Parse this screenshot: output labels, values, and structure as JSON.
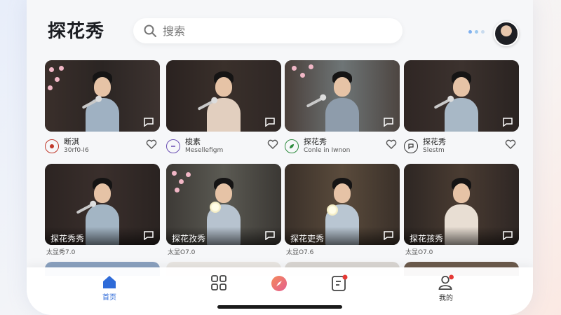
{
  "app": {
    "title": "探花秀"
  },
  "search": {
    "placeholder": "搜索"
  },
  "header": {
    "dot_colors": [
      "#7fb0ef",
      "#9ec9ee",
      "#c9dbee"
    ]
  },
  "colors": {
    "accent": "#2f6bd8",
    "notify": "#e53935",
    "compass": "#ef7a4a"
  },
  "cards_row1": [
    {
      "name": "断淇",
      "sub": "30rf0-I6",
      "logo": "red-badge-icon"
    },
    {
      "name": "梭素",
      "sub": "Mesellefigm",
      "logo": "purple-chat-icon"
    },
    {
      "name": "探花秀",
      "sub": "Conle in Iwnon",
      "logo": "green-leaf-icon"
    },
    {
      "name": "探花秀",
      "sub": "Slestm",
      "logo": "dark-chat-icon"
    }
  ],
  "cards_row2": [
    {
      "title": "探花秀秀",
      "caption": "太显秀7.0"
    },
    {
      "title": "探花孜秀",
      "caption": "太显O7.0"
    },
    {
      "title": "探花吏秀",
      "caption": "太显O7.6"
    },
    {
      "title": "探花孩秀",
      "caption": "太显O7.0"
    }
  ],
  "tabbar": {
    "tabs": [
      {
        "label": "首页",
        "icon": "home-icon",
        "active": true
      },
      {
        "label": "",
        "icon": "grid-icon",
        "active": false
      },
      {
        "label": "",
        "icon": "compass-icon",
        "active": false
      },
      {
        "label": "",
        "icon": "list-notification-icon",
        "active": false
      },
      {
        "label": "我的",
        "icon": "profile-icon",
        "active": false
      }
    ]
  }
}
